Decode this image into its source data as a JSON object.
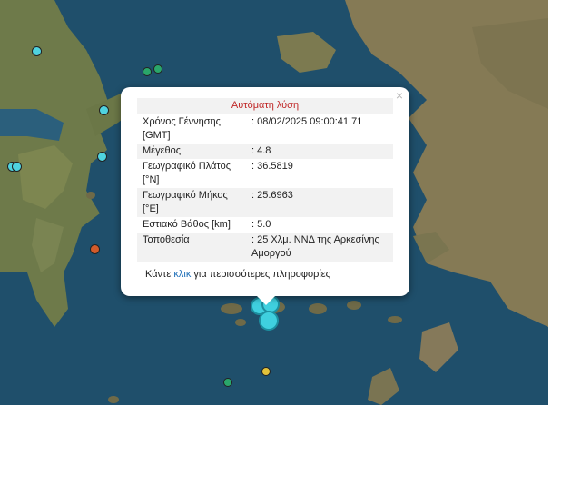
{
  "popup": {
    "title": "Αυτόματη λύση",
    "close_symbol": "×",
    "rows": [
      {
        "label": "Χρόνος Γέννησης [GMT]",
        "value": ": 08/02/2025 09:00:41.71"
      },
      {
        "label": "Μέγεθος",
        "value": ": 4.8"
      },
      {
        "label": "Γεωγραφικό Πλάτος [°N]",
        "value": ": 36.5819"
      },
      {
        "label": "Γεωγραφικό Μήκος [°E]",
        "value": ": 25.6963"
      },
      {
        "label": "Εστιακό Βάθος [km]",
        "value": ": 5.0"
      },
      {
        "label": "Τοποθεσία",
        "value": ": 25 Χλμ. ΝΝΔ της Αρκεσίνης Αμοργού"
      }
    ],
    "more_prefix": "Κάντε ",
    "more_link": "κλικ",
    "more_suffix": " για περισσότερες πληροφορίες"
  },
  "colors": {
    "sea": "#1f4f6b",
    "land": "#6e7a4a",
    "title_text": "#c02828",
    "link": "#1f6fb8",
    "marker_cyan": "#4fd3df",
    "marker_green": "#2aa66a",
    "marker_orange": "#d35b2a",
    "marker_yellow": "#e2c23a"
  }
}
